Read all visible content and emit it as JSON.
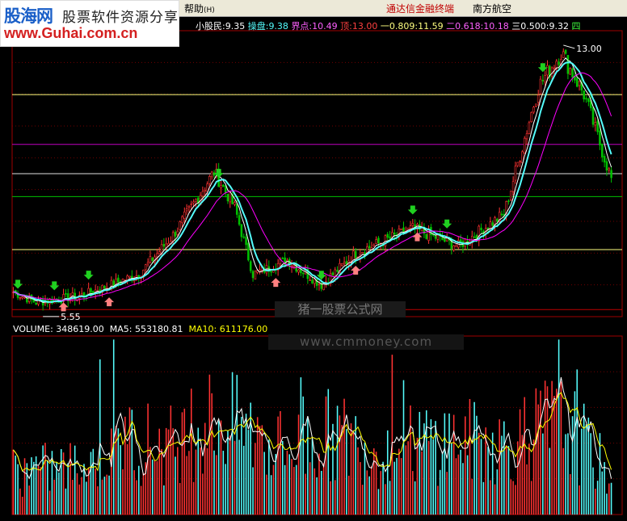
{
  "logo": {
    "brand": "股海网",
    "slogan": "股票软件资源分享",
    "url": "www.Guhai.com.cn"
  },
  "menubar": {
    "help": "帮助",
    "help_key": "(H)",
    "broker": "通达信金融终端",
    "stock": "南方航空"
  },
  "indicator": {
    "xiaogumin_label": "小股民:",
    "xiaogumin": "9.35",
    "caopan_label": "操盘:",
    "caopan": "9.38",
    "jiedian_label": "界点:",
    "jiedian": "10.49",
    "ding_label": "顶:",
    "ding": "13.00",
    "yi_label": "一0.809:",
    "yi": "11.59",
    "er_label": "二0.618:",
    "er": "10.18",
    "san_label": "三0.500:",
    "san": "9.32",
    "si_label": "四"
  },
  "price_annotations": {
    "high": "13.00",
    "low": "5.55"
  },
  "volume": {
    "label": "VOLUME:",
    "value": "348619.00",
    "ma5_label": "MA5:",
    "ma5": "553180.81",
    "ma10_label": "MA10:",
    "ma10": "611176.00"
  },
  "watermark": {
    "line1": "猪一股票公式网",
    "line2": "www.cmmoney.com"
  },
  "colors": {
    "up": "#ff3232",
    "down": "#54fcfc",
    "down_candle": "#00c000",
    "ma_cyan": "#54fcfc",
    "ma_magenta": "#ff00ff",
    "ma_white": "#ffffff",
    "grid_red": "#a00000",
    "line_yellow": "#ffff80",
    "line_magenta": "#c000c0",
    "line_green": "#00c000",
    "line_red": "#c00000"
  },
  "chart_data": {
    "type": "line",
    "price_range": [
      5.3,
      13.4
    ],
    "ref_lines": [
      {
        "name": "一0.809",
        "value": 11.59,
        "color": "yellow"
      },
      {
        "name": "二0.618",
        "value": 10.18,
        "color": "magenta"
      },
      {
        "name": "",
        "value": 9.35,
        "color": "white"
      },
      {
        "name": "",
        "value": 8.7,
        "color": "green"
      },
      {
        "name": "",
        "value": 7.2,
        "color": "yellow"
      },
      {
        "name": "",
        "value": 5.5,
        "color": "red"
      }
    ],
    "close_keypoints": [
      [
        0,
        6.0
      ],
      [
        10,
        5.7
      ],
      [
        30,
        5.9
      ],
      [
        55,
        6.5
      ],
      [
        70,
        7.6
      ],
      [
        88,
        9.4
      ],
      [
        97,
        8.4
      ],
      [
        105,
        6.5
      ],
      [
        120,
        6.9
      ],
      [
        135,
        6.2
      ],
      [
        150,
        7.1
      ],
      [
        175,
        7.8
      ],
      [
        195,
        7.3
      ],
      [
        215,
        8.2
      ],
      [
        230,
        11.8
      ],
      [
        240,
        12.8
      ],
      [
        250,
        11.6
      ],
      [
        262,
        9.2
      ]
    ],
    "n_bars": 263,
    "volume_range": [
      0,
      1500000
    ],
    "volume_keypoints": [
      [
        0,
        400000
      ],
      [
        30,
        450000
      ],
      [
        50,
        700000
      ],
      [
        70,
        650000
      ],
      [
        88,
        900000
      ],
      [
        100,
        800000
      ],
      [
        120,
        600000
      ],
      [
        140,
        750000
      ],
      [
        160,
        600000
      ],
      [
        190,
        700000
      ],
      [
        220,
        650000
      ],
      [
        240,
        900000
      ],
      [
        262,
        350000
      ]
    ],
    "up_arrows_idx": [
      22,
      42,
      115,
      150,
      177
    ],
    "down_arrows_idx": [
      2,
      18,
      33,
      90,
      135,
      175,
      190,
      232
    ],
    "high_label": "13.00",
    "low_label": "5.55"
  }
}
